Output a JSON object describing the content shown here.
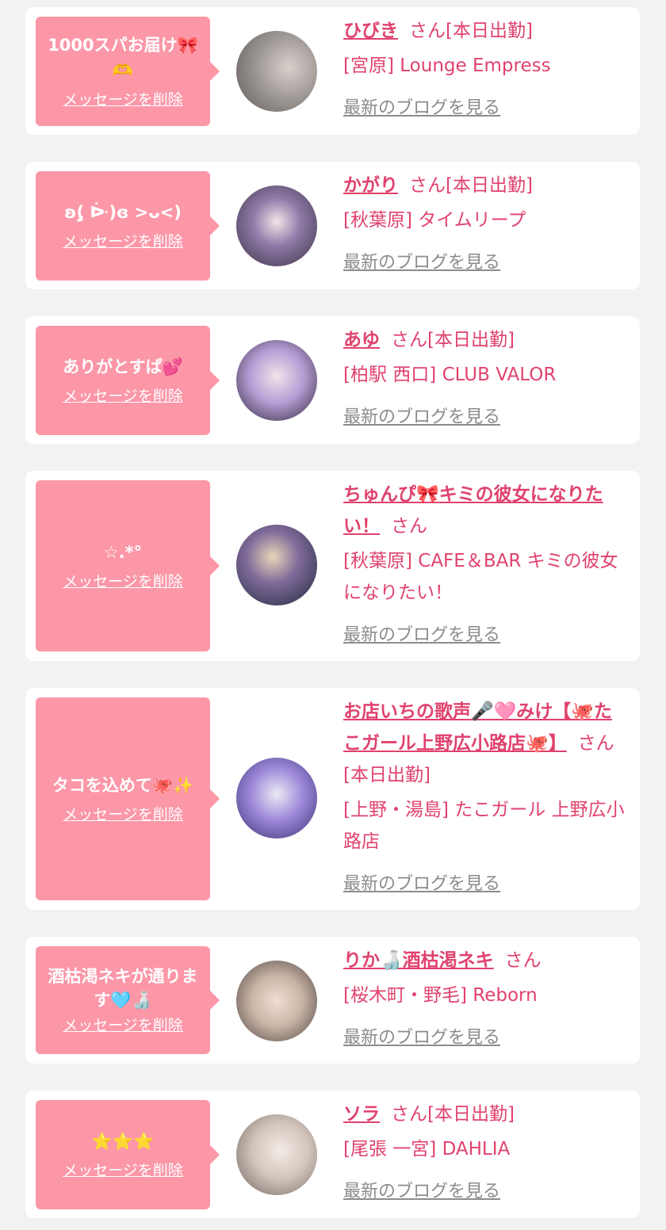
{
  "cards": [
    {
      "message": "1000スパお届け🎀🫶",
      "delete_label": "メッセージを削除",
      "name": "ひびき",
      "suffix": "さん[本日出勤]",
      "shop": "[宮原] Lounge Empress",
      "blog_label": "最新のブログを見る"
    },
    {
      "message": "ʚ(̨̡ ᐕ)ɞ >ᴗ<)",
      "delete_label": "メッセージを削除",
      "name": "かがり",
      "suffix": "さん[本日出勤]",
      "shop": "[秋葉原] タイムリープ",
      "blog_label": "最新のブログを見る"
    },
    {
      "message": "ありがとすぱ💕",
      "delete_label": "メッセージを削除",
      "name": "あゆ",
      "suffix": "さん[本日出勤]",
      "shop": "[柏駅 西口] CLUB VALOR",
      "blog_label": "最新のブログを見る"
    },
    {
      "message": "☆.*°",
      "delete_label": "メッセージを削除",
      "name": "ちゅんぴ🎀キミの彼女になりたい！",
      "suffix": "さん",
      "shop": "[秋葉原] CAFE＆BAR キミの彼女になりたい！",
      "blog_label": "最新のブログを見る"
    },
    {
      "message": "タコを込めて🐙✨",
      "delete_label": "メッセージを削除",
      "name": "お店いちの歌声🎤🩷みけ【🐙たこガール上野広小路店🐙】",
      "suffix": "さん[本日出勤]",
      "shop": "[上野・湯島] たこガール 上野広小路店",
      "blog_label": "最新のブログを見る"
    },
    {
      "message": "酒枯渇ネキが通ります🩵🍶",
      "delete_label": "メッセージを削除",
      "name": "りか🍶酒枯渇ネキ",
      "suffix": "さん",
      "shop": "[桜木町・野毛] Reborn",
      "blog_label": "最新のブログを見る"
    },
    {
      "message": "⭐️⭐️⭐️",
      "delete_label": "メッセージを削除",
      "name": "ソラ",
      "suffix": "さん[本日出勤]",
      "shop": "[尾張 一宮] DAHLIA",
      "blog_label": "最新のブログを見る"
    }
  ],
  "colors": {
    "page_bg": "#f2f2f2",
    "card_bg": "#ffffff",
    "bubble_bg": "#fc97a8",
    "accent": "#e0426d",
    "muted_link": "#8c8c8c"
  }
}
